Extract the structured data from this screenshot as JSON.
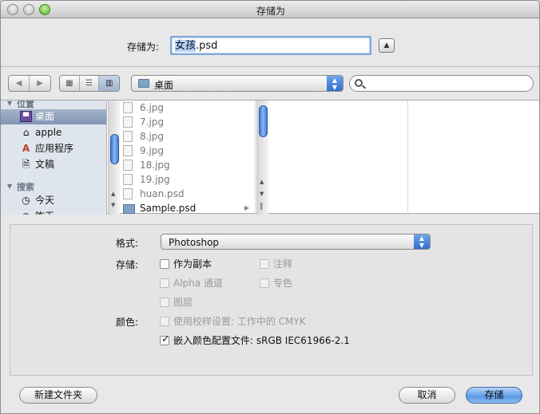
{
  "window": {
    "title": "存储为"
  },
  "saveas": {
    "label": "存储为:",
    "filename_selected": "女孩",
    "filename_rest": ".psd"
  },
  "toolbar": {
    "location": "桌面",
    "search_placeholder": ""
  },
  "sidebar": {
    "section_places": "位置",
    "places": [
      {
        "label": "桌面",
        "icon": "desktop-icon",
        "selected": true
      },
      {
        "label": "apple",
        "icon": "home-icon",
        "selected": false
      },
      {
        "label": "应用程序",
        "icon": "applications-icon",
        "selected": false
      },
      {
        "label": "文稿",
        "icon": "documents-icon",
        "selected": false
      }
    ],
    "section_search": "搜索",
    "search_items": [
      {
        "label": "今天",
        "icon": "clock-icon"
      },
      {
        "label": "昨天",
        "icon": "clock-icon"
      }
    ]
  },
  "files": [
    {
      "name": "6.jpg",
      "type": "image",
      "enabled": false
    },
    {
      "name": "7.jpg",
      "type": "image",
      "enabled": false
    },
    {
      "name": "8.jpg",
      "type": "image",
      "enabled": false
    },
    {
      "name": "9.jpg",
      "type": "image",
      "enabled": false
    },
    {
      "name": "18.jpg",
      "type": "image",
      "enabled": false
    },
    {
      "name": "19.jpg",
      "type": "image",
      "enabled": false
    },
    {
      "name": "huan.psd",
      "type": "image",
      "enabled": false
    },
    {
      "name": "Sample.psd",
      "type": "folder",
      "enabled": true
    }
  ],
  "options": {
    "format_label": "格式:",
    "format_value": "Photoshop",
    "save_label": "存储:",
    "as_copy": "作为副本",
    "notes": "注释",
    "alpha": "Alpha 通道",
    "spot": "专色",
    "layers": "图层",
    "color_label": "颜色:",
    "use_proof": "使用校样设置: 工作中的 CMYK",
    "embed_profile": "嵌入颜色配置文件: sRGB IEC61966-2.1"
  },
  "buttons": {
    "new_folder": "新建文件夹",
    "cancel": "取消",
    "save": "存储"
  },
  "colors": {
    "accent": "#3d7ad4",
    "selection": "#b5d3ff"
  }
}
